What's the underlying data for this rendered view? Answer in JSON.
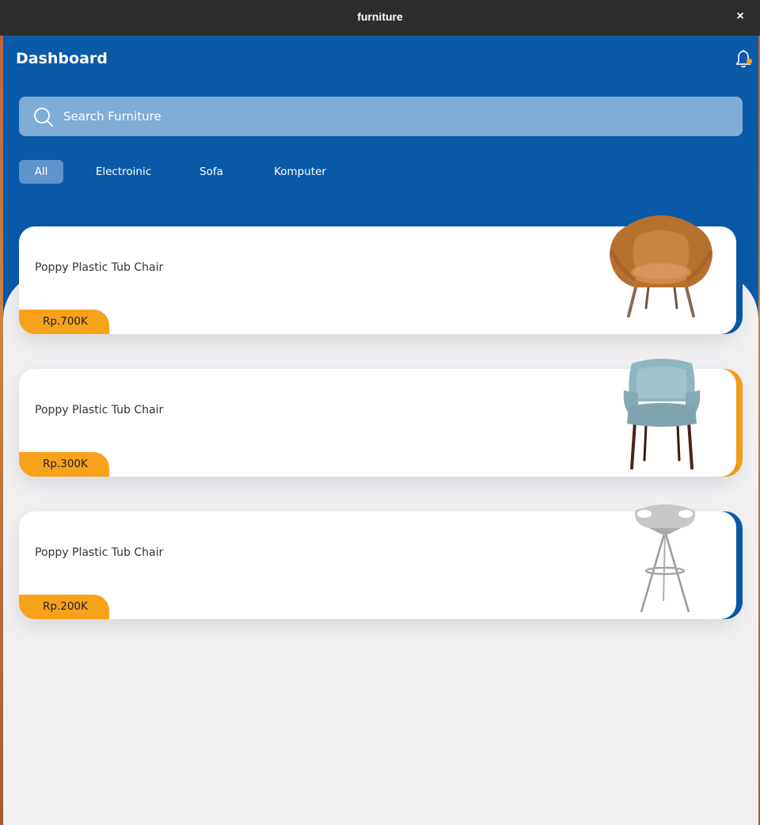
{
  "window": {
    "title": "furniture",
    "close_glyph": "×"
  },
  "header": {
    "title": "Dashboard",
    "notification_icon": "bell-icon"
  },
  "search": {
    "placeholder": "Search Furniture",
    "value": "",
    "icon": "search-icon"
  },
  "categories": [
    {
      "label": "All",
      "active": true
    },
    {
      "label": "Electroinic",
      "active": false
    },
    {
      "label": "Sofa",
      "active": false
    },
    {
      "label": "Komputer",
      "active": false
    }
  ],
  "products": [
    {
      "name": "Poppy Plastic Tub Chair",
      "price": "Rp.700K",
      "accent": "#0a5aa8",
      "image": "armchair-image"
    },
    {
      "name": "Poppy Plastic Tub Chair",
      "price": "Rp.300K",
      "accent": "#f7a21b",
      "image": "dining-chair-image"
    },
    {
      "name": "Poppy Plastic Tub Chair",
      "price": "Rp.200K",
      "accent": "#0a5aa8",
      "image": "bar-stool-image"
    }
  ],
  "colors": {
    "primary": "#0a5aa8",
    "accent": "#f7a21b",
    "background": "#f0eff2",
    "search_bg": "#7fadd6"
  }
}
